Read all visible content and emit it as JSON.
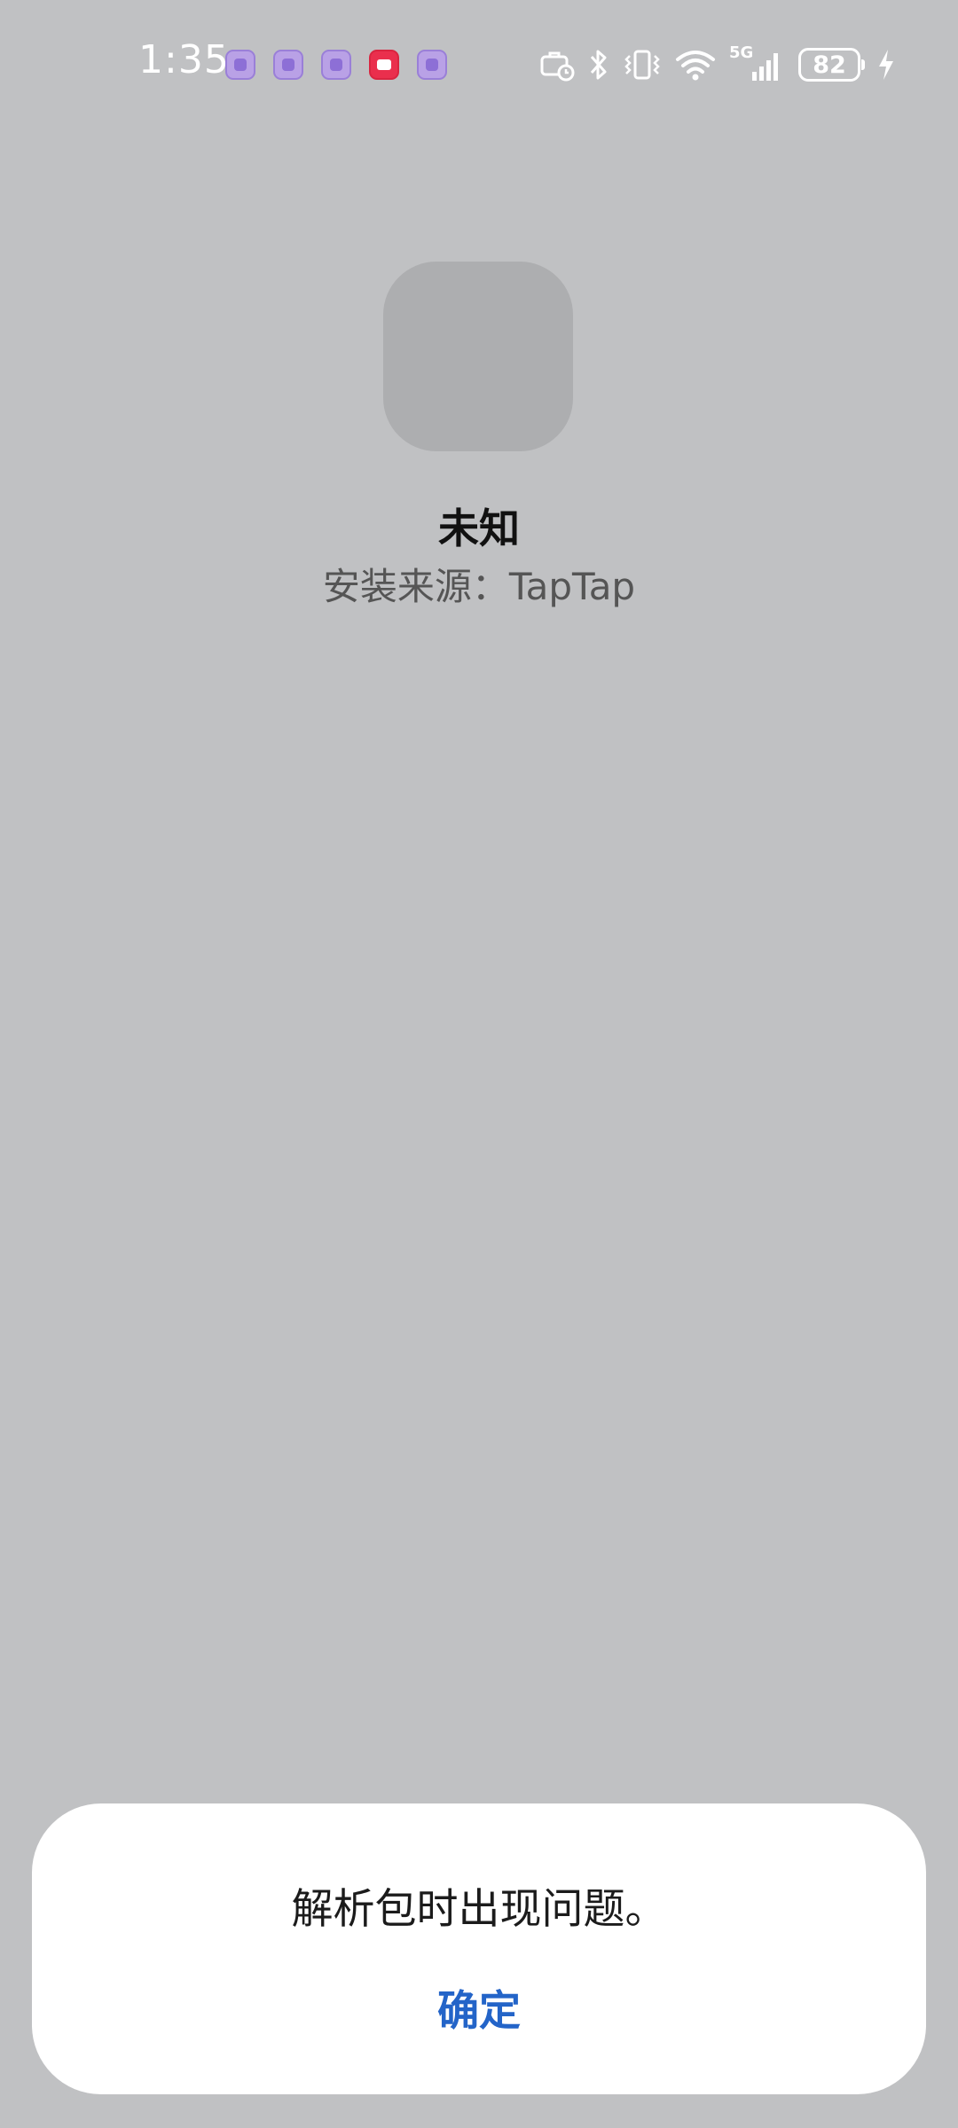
{
  "status_bar": {
    "time": "1:35",
    "battery_level": "82",
    "network_label": "5G",
    "notification_icons": [
      "app-notification-icon",
      "app-notification-icon",
      "app-notification-icon",
      "mail-notification-icon",
      "app-notification-icon"
    ],
    "system_icons": [
      "work-profile-icon",
      "bluetooth-icon",
      "vibrate-icon",
      "wifi-icon",
      "cellular-signal-icon",
      "battery-icon",
      "charging-icon"
    ]
  },
  "app": {
    "name": "未知",
    "install_source": "安装来源：TapTap"
  },
  "dialog": {
    "message": "解析包时出现问题。",
    "confirm_label": "确定"
  },
  "colors": {
    "background": "#c0c1c3",
    "accent": "#2364c8",
    "icon_placeholder": "#adaeb0"
  }
}
